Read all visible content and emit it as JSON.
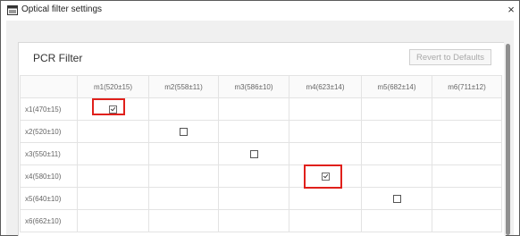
{
  "window": {
    "title": "Optical filter settings",
    "close_glyph": "×",
    "icon": "window-app-icon"
  },
  "panel": {
    "title": "PCR Filter",
    "revert_label": "Revert to Defaults"
  },
  "grid": {
    "columns": [
      "m1(520±15)",
      "m2(558±11)",
      "m3(586±10)",
      "m4(623±14)",
      "m5(682±14)",
      "m6(711±12)"
    ],
    "rows": [
      {
        "label": "x1(470±15)",
        "checkboxes": [
          true,
          null,
          null,
          null,
          null,
          null
        ]
      },
      {
        "label": "x2(520±10)",
        "checkboxes": [
          null,
          false,
          null,
          null,
          null,
          null
        ]
      },
      {
        "label": "x3(550±11)",
        "checkboxes": [
          null,
          null,
          false,
          null,
          null,
          null
        ]
      },
      {
        "label": "x4(580±10)",
        "checkboxes": [
          null,
          null,
          null,
          true,
          null,
          null
        ]
      },
      {
        "label": "x5(640±10)",
        "checkboxes": [
          null,
          null,
          null,
          null,
          false,
          null
        ]
      },
      {
        "label": "x6(662±10)",
        "checkboxes": [
          null,
          null,
          null,
          null,
          null,
          null
        ]
      }
    ]
  },
  "colors": {
    "highlight": "#e0201b",
    "panel_background": "#ffffff",
    "window_background": "#f0f0f0"
  }
}
